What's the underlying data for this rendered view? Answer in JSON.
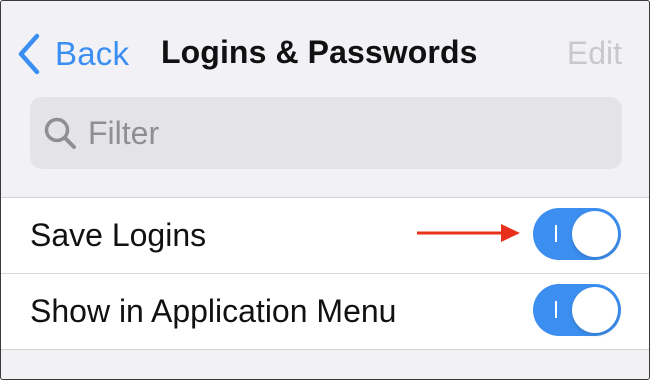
{
  "nav": {
    "back_label": "Back",
    "title": "Logins & Passwords",
    "edit_label": "Edit"
  },
  "search": {
    "placeholder": "Filter",
    "icon": "magnifying-glass-icon"
  },
  "settings": {
    "items": [
      {
        "label": "Save Logins",
        "enabled": true
      },
      {
        "label": "Show in Application Menu",
        "enabled": true
      }
    ]
  },
  "annotation": {
    "type": "arrow",
    "target": "Save Logins toggle",
    "color": "#e8301a"
  },
  "colors": {
    "accent": "#3b8ff2",
    "toggle_on": "#3c8ff0",
    "background": "#f2f2f6",
    "edit_disabled": "#c9c9cd"
  }
}
